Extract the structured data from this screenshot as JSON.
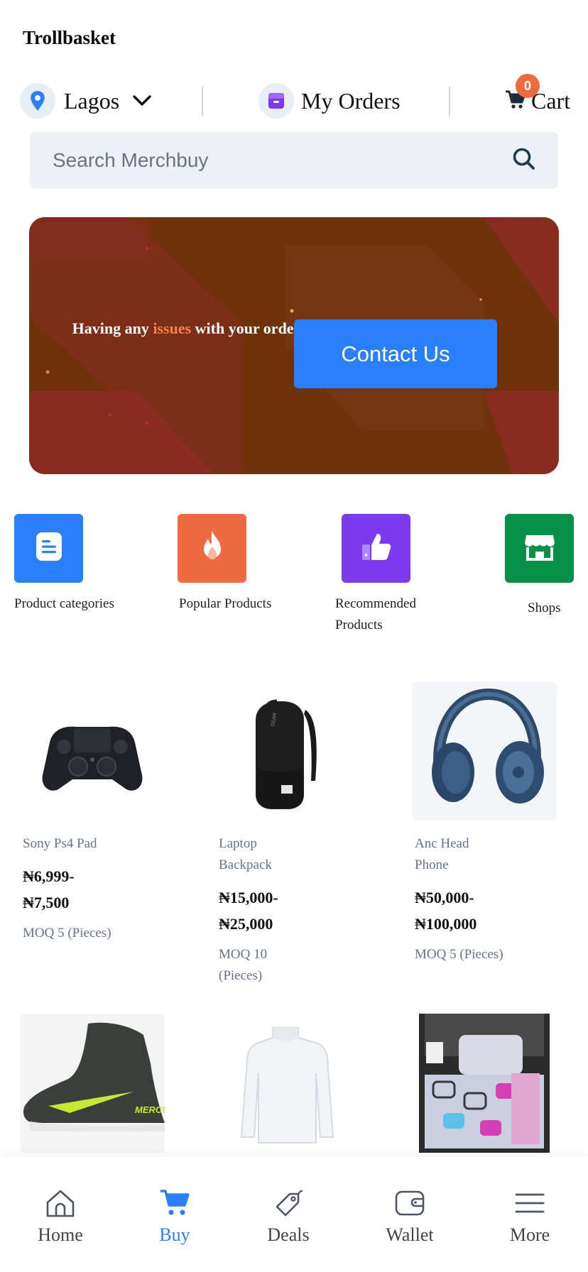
{
  "app": {
    "title": "Trollbasket"
  },
  "header": {
    "location": "Lagos",
    "orders_label": "My Orders",
    "cart_label": "Cart",
    "cart_count": "0"
  },
  "search": {
    "placeholder": "Search Merchbuy"
  },
  "banner": {
    "text_before": "Having any ",
    "text_highlight": "issues",
    "text_after": " with your order?",
    "button_label": "Contact Us"
  },
  "categories": [
    {
      "label": "Product categories",
      "icon": "document-icon",
      "color": "#2a80fb"
    },
    {
      "label": "Popular Products",
      "icon": "flame-icon",
      "color": "#ef6a3e"
    },
    {
      "label": "Recommended Products",
      "icon": "thumbs-up-icon",
      "color": "#7c3aed"
    },
    {
      "label": "Shops",
      "icon": "storefront-icon",
      "color": "#069046"
    }
  ],
  "products": [
    {
      "name": "Sony Ps4 Pad",
      "price_min": "₦6,999-",
      "price_max": "₦7,500",
      "moq": "MOQ 5 (Pieces)"
    },
    {
      "name": "Laptop Backpack",
      "price_min": "₦15,000-",
      "price_max": "₦25,000",
      "moq": "MOQ 10 (Pieces)"
    },
    {
      "name": "Anc Head Phone",
      "price_min": "₦50,000-",
      "price_max": "₦100,000",
      "moq": "MOQ 5 (Pieces)"
    }
  ],
  "products_row2": [
    {
      "image": "football-boot"
    },
    {
      "image": "white-turtleneck"
    },
    {
      "image": "bedding-set"
    }
  ],
  "nav": [
    {
      "label": "Home",
      "icon": "home-icon",
      "active": false
    },
    {
      "label": "Buy",
      "icon": "cart-icon",
      "active": true
    },
    {
      "label": "Deals",
      "icon": "tag-icon",
      "active": false
    },
    {
      "label": "Wallet",
      "icon": "wallet-icon",
      "active": false
    },
    {
      "label": "More",
      "icon": "menu-icon",
      "active": false
    }
  ],
  "colors": {
    "accent": "#2a80fb",
    "orange": "#ef6a3e",
    "banner_bg": "#6e330b"
  }
}
